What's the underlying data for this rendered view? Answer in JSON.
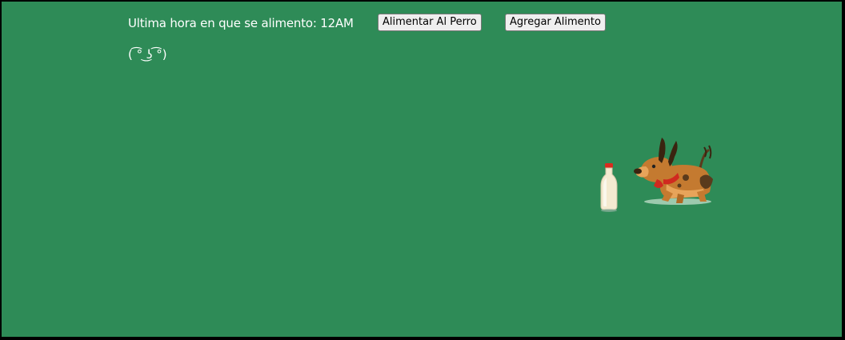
{
  "status": {
    "last_fed_label": "Ultima hora en que se alimento: 12AM",
    "face": "( ͡° ͜ʖ ͡°)"
  },
  "buttons": {
    "feed_label": "Alimentar Al Perro",
    "add_food_label": "Agregar Alimento"
  },
  "colors": {
    "background": "#2e8b57",
    "text": "#ffffff"
  },
  "images": {
    "milk": "milk-bottle-icon",
    "dog": "dog-illustration"
  }
}
